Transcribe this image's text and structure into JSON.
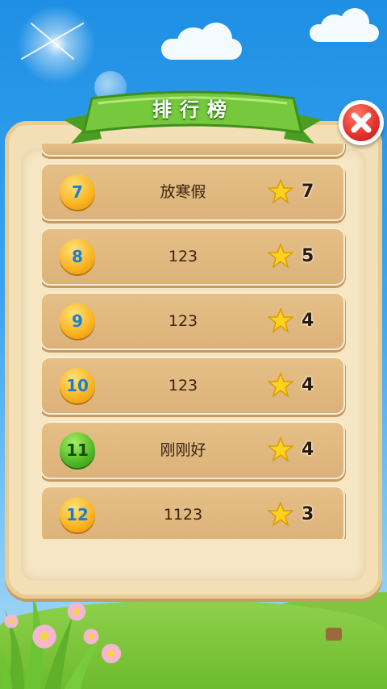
{
  "title": "排行榜",
  "close_icon": "close-icon",
  "rows": [
    {
      "rank": "7",
      "name": "放寒假",
      "score": "7",
      "badge": "gold"
    },
    {
      "rank": "8",
      "name": "123",
      "score": "5",
      "badge": "gold"
    },
    {
      "rank": "9",
      "name": "123",
      "score": "4",
      "badge": "gold"
    },
    {
      "rank": "10",
      "name": "123",
      "score": "4",
      "badge": "gold"
    },
    {
      "rank": "11",
      "name": "刚刚好",
      "score": "4",
      "badge": "green"
    },
    {
      "rank": "12",
      "name": "1123",
      "score": "3",
      "badge": "gold"
    }
  ],
  "colors": {
    "sky_top": "#1e8fe4",
    "ribbon_green": "#6cc435",
    "board": "#f3dfb5",
    "row": "#dcb27a",
    "close_red": "#e2312a"
  }
}
